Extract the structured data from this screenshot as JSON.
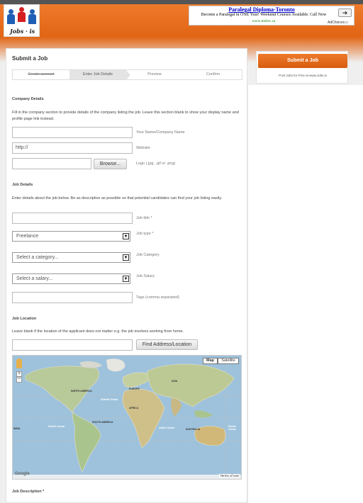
{
  "ad": {
    "title": "Paralegal Diploma-Toronto",
    "text": "Become a Paralegal in ONE Year! Weekend Courses Available. Call Now",
    "url": "www.mcbrc.ca",
    "choices": "AdChoices ▷"
  },
  "logo": {
    "text": "Jobs · is"
  },
  "page": {
    "title": "Submit a Job"
  },
  "steps": [
    "Create account",
    "Enter Job Details",
    "Preview",
    "Confirm"
  ],
  "company": {
    "title": "Company Details",
    "description": "Fill in the company section to provide details of the company listing the job. Leave this section blank to show your display name and profile page link instead.",
    "name_hint": "Your Name/Company Name",
    "website_value": "http://",
    "website_hint": "Website",
    "browse_label": "Browse...",
    "logo_hint": "Logo (.jpg, .gif or .png)"
  },
  "job": {
    "title": "Job Details",
    "description": "Enter details about the job below. Be as descriptive as possible so that potential candidates can find your job listing easily.",
    "title_hint": "Job title *",
    "type_value": "Freelance",
    "type_hint": "Job type *",
    "category_value": "Select a category...",
    "category_hint": "Job Category",
    "salary_value": "Select a salary...",
    "salary_hint": "Job Salary",
    "tags_hint": "Tags (comma separated)"
  },
  "location": {
    "title": "Job Location",
    "description": "Leave blank if the location of the applicant does not matter e.g. the job involves working from home.",
    "find_label": "Find Address/Location"
  },
  "map": {
    "map_label": "Map",
    "satellite_label": "Satellite",
    "zoom_in": "+",
    "zoom_out": "−",
    "terms": "Terms of Use",
    "logo": "Google",
    "labels": {
      "north_america": "NORTH AMERICA",
      "europe": "EUROPE",
      "asia": "ASIA",
      "africa": "AFRICA",
      "south_america": "SOUTH AMERICA",
      "australia": "AUSTRALIA",
      "atlantic": "Atlantic Ocean",
      "pacific_left": "Pacific Ocean",
      "indian": "Indian Ocean",
      "pacific_right": "Pacific Ocean",
      "india": "INDIA"
    }
  },
  "description_section": {
    "title": "Job Description *"
  },
  "sidebar": {
    "submit_label": "Submit a Job",
    "text": "Post Jobs for Free at www.Jobs.is"
  }
}
